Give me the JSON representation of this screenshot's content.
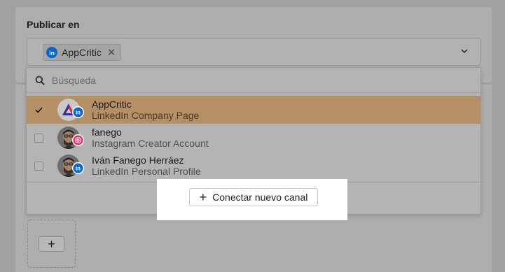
{
  "section": {
    "title": "Publicar en"
  },
  "selector": {
    "chip_label": "AppCritic",
    "chip_remove": "✕"
  },
  "search": {
    "placeholder": "Búsqueda",
    "value": ""
  },
  "options": [
    {
      "name": "AppCritic",
      "subtitle": "LinkedIn Company Page",
      "network": "linkedin-icon",
      "checked": true
    },
    {
      "name": "fanego",
      "subtitle": "Instagram Creator Account",
      "network": "instagram-icon",
      "checked": false
    },
    {
      "name": "Iván Fanego Herráez",
      "subtitle": "LinkedIn Personal Profile",
      "network": "linkedin-icon",
      "checked": false
    }
  ],
  "connect": {
    "plus": "+",
    "label": "Conectar nuevo canal"
  },
  "add_tile": {
    "plus": "+"
  },
  "colors": {
    "linkedin": "#0a66c2",
    "instagram": "#e1306c",
    "selected_row": "#b58f66"
  }
}
